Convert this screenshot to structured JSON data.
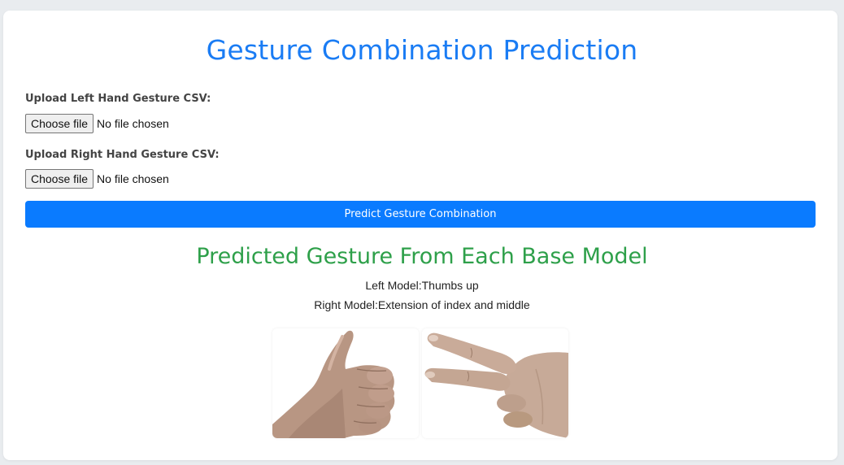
{
  "page": {
    "title": "Gesture Combination Prediction"
  },
  "form": {
    "left_label": "Upload Left Hand Gesture CSV:",
    "right_label": "Upload Right Hand Gesture CSV:",
    "choose_file_label": "Choose file",
    "left_file_status": "No file chosen",
    "right_file_status": "No file chosen",
    "submit_label": "Predict Gesture Combination"
  },
  "results": {
    "heading": "Predicted Gesture From Each Base Model",
    "left_line": "Left Model:Thumbs up",
    "right_line": "Right Model:Extension of index and middle"
  },
  "images": [
    {
      "icon": "thumbs-up-hand-image"
    },
    {
      "icon": "index-middle-extension-hand-image"
    }
  ],
  "colors": {
    "title": "#1a7cf4",
    "subtitle": "#2ea04a",
    "button": "#0a7bff",
    "background": "#e9ecef"
  }
}
